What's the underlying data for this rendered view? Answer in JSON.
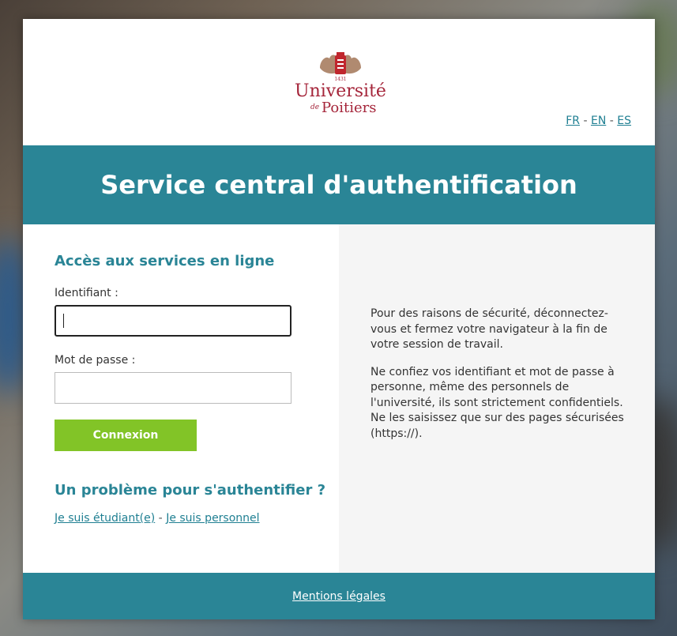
{
  "logo": {
    "name_line1": "Université",
    "name_line2_prefix": "de",
    "name_line2": "Poitiers",
    "year": "1431",
    "color": "#a5253a"
  },
  "languages": [
    "FR",
    "EN",
    "ES"
  ],
  "banner_title": "Service central d'authentification",
  "login": {
    "heading": "Accès aux services en ligne",
    "username_label": "Identifiant :",
    "username_value": "",
    "password_label": "Mot de passe :",
    "password_value": "",
    "submit_label": "Connexion"
  },
  "help": {
    "heading": "Un problème pour s'authentifier ?",
    "student_link": "Je suis étudiant(e)",
    "separator": " - ",
    "staff_link": "Je suis personnel"
  },
  "info": {
    "paragraph1": "Pour des raisons de sécurité, déconnectez-vous et fermez votre navigateur à la fin de votre session de travail.",
    "paragraph2": "Ne confiez vos identifiant et mot de passe à personne, même des personnels de l'université, ils sont strictement confidentiels. Ne les saisissez que sur des pages sécurisées (https://)."
  },
  "footer": {
    "legal_link": "Mentions légales"
  },
  "colors": {
    "accent": "#2a8596",
    "button": "#82c427",
    "link": "#1f7f92"
  }
}
